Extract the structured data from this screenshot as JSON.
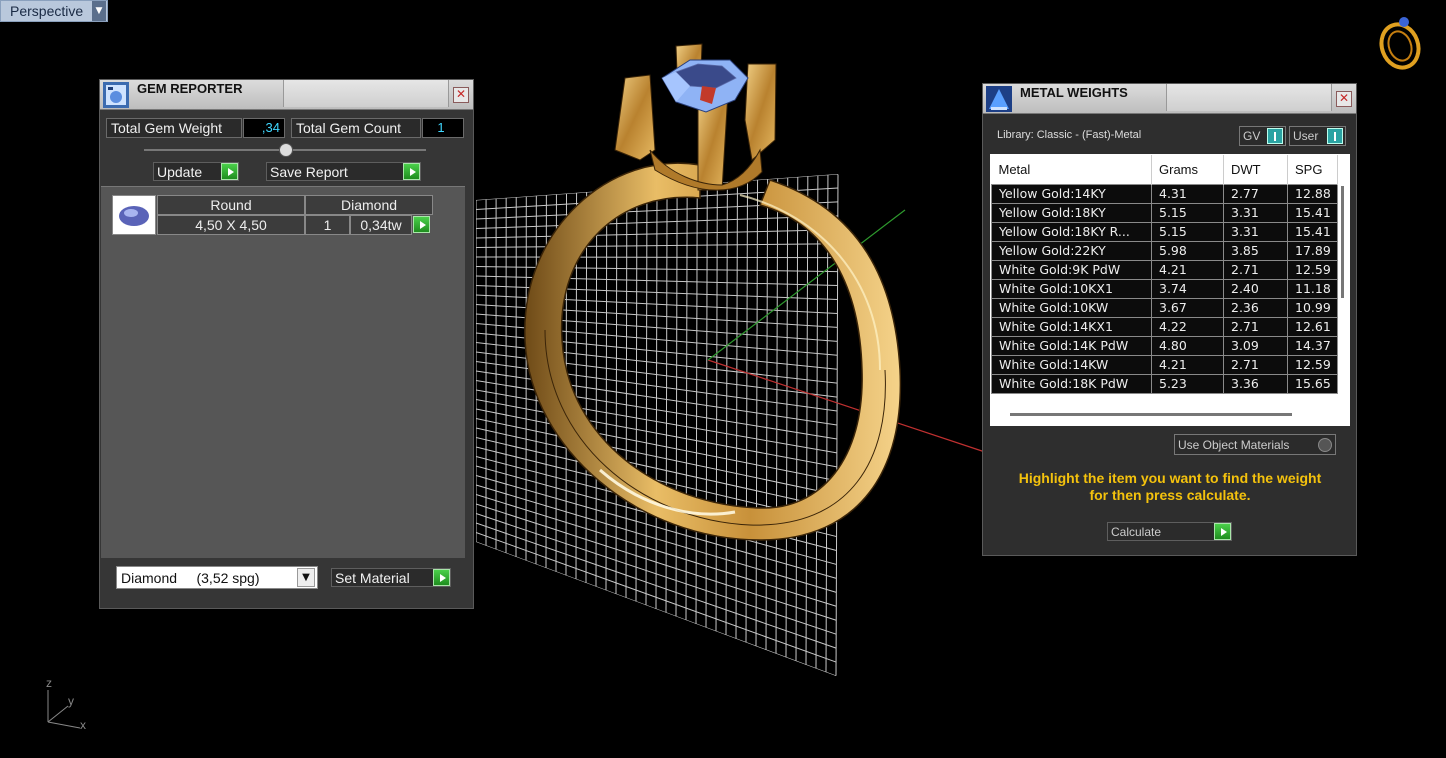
{
  "viewport": {
    "name": "Perspective",
    "axes": {
      "z": "z",
      "y": "y",
      "x": "x"
    }
  },
  "gem_reporter": {
    "title": "GEM REPORTER",
    "total_weight_label": "Total Gem Weight",
    "total_weight_value": ",34",
    "total_count_label": "Total Gem Count",
    "total_count_value": "1",
    "update_label": "Update",
    "save_report_label": "Save Report",
    "gem": {
      "shape": "Round",
      "material": "Diamond",
      "size": "4,50 X 4,50",
      "count": "1",
      "weight": "0,34tw"
    },
    "material_select": "Diamond     (3,52 spg)",
    "set_material_label": "Set Material"
  },
  "metal_weights": {
    "title": "METAL WEIGHTS",
    "library": "Library: Classic - (Fast)-Metal",
    "gv_label": "GV",
    "user_label": "User",
    "columns": [
      "Metal",
      "Grams",
      "DWT",
      "SPG"
    ],
    "rows": [
      [
        "Yellow Gold:14KY",
        "4.31",
        "2.77",
        "12.88"
      ],
      [
        "Yellow Gold:18KY",
        "5.15",
        "3.31",
        "15.41"
      ],
      [
        "Yellow Gold:18KY R...",
        "5.15",
        "3.31",
        "15.41"
      ],
      [
        "Yellow Gold:22KY",
        "5.98",
        "3.85",
        "17.89"
      ],
      [
        "White Gold:9K PdW",
        "4.21",
        "2.71",
        "12.59"
      ],
      [
        "White Gold:10KX1",
        "3.74",
        "2.40",
        "11.18"
      ],
      [
        "White Gold:10KW",
        "3.67",
        "2.36",
        "10.99"
      ],
      [
        "White Gold:14KX1",
        "4.22",
        "2.71",
        "12.61"
      ],
      [
        "White Gold:14K PdW",
        "4.80",
        "3.09",
        "14.37"
      ],
      [
        "White Gold:14KW",
        "4.21",
        "2.71",
        "12.59"
      ],
      [
        "White Gold:18K PdW",
        "5.23",
        "3.36",
        "15.65"
      ]
    ],
    "use_object_materials": "Use Object Materials",
    "hint_line1": "Highlight the item you want to find the weight",
    "hint_line2": "for then press calculate.",
    "calculate_label": "Calculate"
  },
  "colors": {
    "accent_green": "#2fb62f",
    "value_cyan": "#3fd7ff",
    "hint_yellow": "#f4c20d",
    "gold": "#d9a441"
  }
}
